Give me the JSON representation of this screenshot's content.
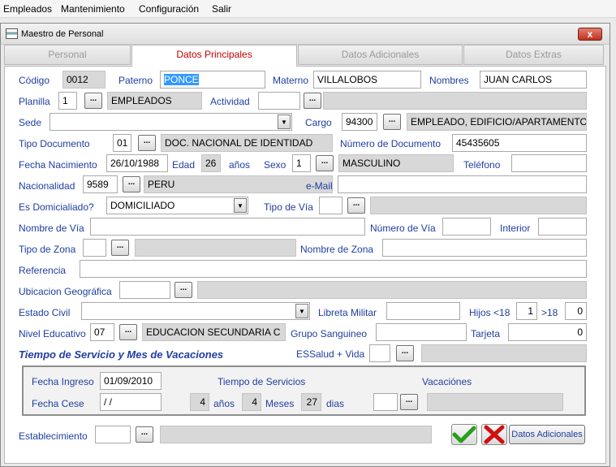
{
  "menu": {
    "empleados": "Empleados",
    "mantenimiento": "Mantenimiento",
    "configuracion": "Configuración",
    "salir": "Salir"
  },
  "window": {
    "title": "Maestro de Personal",
    "close": "x"
  },
  "tabs": {
    "personal": "Personal",
    "principales": "Datos Principales",
    "adicionales": "Datos Adicionales",
    "extras": "Datos Extras"
  },
  "labels": {
    "codigo": "Código",
    "paterno": "Paterno",
    "materno": "Materno",
    "nombres": "Nombres",
    "planilla": "Planilla",
    "actividad": "Actividad",
    "sede": "Sede",
    "cargo": "Cargo",
    "tipo_documento": "Tipo Documento",
    "numero_documento": "Número de Documento",
    "fecha_nacimiento": "Fecha Nacimiento",
    "edad": "Edad",
    "anos": "años",
    "sexo": "Sexo",
    "telefono": "Teléfono",
    "nacionalidad": "Nacionalidad",
    "email": "e-Mail",
    "es_domiciliado": "Es Domicialiado?",
    "tipo_via": "Tipo de Vía",
    "nombre_via": "Nombre de Vía",
    "numero_via": "Número de Vía",
    "interior": "Interior",
    "tipo_zona": "Tipo de Zona",
    "nombre_zona": "Nombre de Zona",
    "referencia": "Referencia",
    "ubicacion": "Ubicacion Geográfica",
    "estado_civil": "Estado Civil",
    "libreta_militar": "Libreta Militar",
    "hijos_menor": "Hijos <18",
    "hijos_mayor": ">18",
    "nivel_educativo": "Nivel Educativo",
    "grupo_sanguineo": "Grupo Sanguineo",
    "tarjeta": "Tarjeta",
    "essalud": "ESSalud + Vida",
    "fecha_ingreso": "Fecha Ingreso",
    "fecha_cese": "Fecha Cese",
    "tiempo_servicios": "Tiempo de Servicios",
    "vacaciones": "Vacaciónes",
    "anos2": "años",
    "meses": "Meses",
    "dias": "dias",
    "establecimiento": "Establecimiento"
  },
  "section_title": "Tiempo de Servicio y Mes de Vacaciones",
  "values": {
    "codigo": "0012",
    "paterno": "PONCE",
    "materno": "VILLALOBOS",
    "nombres": "JUAN CARLOS",
    "planilla_code": "1",
    "planilla_desc": "EMPLEADOS",
    "actividad": "",
    "sede": "",
    "cargo_code": "94300",
    "cargo_desc": "EMPLEADO, EDIFICIO/APARTAMENTO",
    "tipo_doc_code": "01",
    "tipo_doc_desc": "DOC. NACIONAL DE IDENTIDAD",
    "numero_documento": "45435605",
    "fecha_nacimiento": "26/10/1988",
    "edad": "26",
    "sexo_code": "1",
    "sexo_desc": "MASCULINO",
    "telefono": "",
    "nacionalidad_code": "9589",
    "nacionalidad_desc": "PERU",
    "email": "",
    "domiciliado": "DOMICILIADO",
    "tipo_via": "",
    "nombre_via": "",
    "numero_via": "",
    "interior": "",
    "tipo_zona": "",
    "nombre_zona": "",
    "referencia": "",
    "ubicacion": "",
    "estado_civil": "",
    "libreta_militar": "",
    "hijos_menor": "1",
    "hijos_mayor": "0",
    "nivel_code": "07",
    "nivel_desc": "EDUCACION SECUNDARIA C",
    "grupo_sanguineo": "",
    "tarjeta": "0",
    "essalud": "",
    "fecha_ingreso": "01/09/2010",
    "fecha_cese": " / /",
    "anos": "4",
    "meses": "4",
    "dias": "27",
    "vacaciones": "",
    "establecimiento": ""
  },
  "buttons": {
    "lookup": "...",
    "datos_adicionales": "Datos Adicionales"
  },
  "icons": {
    "combo_arrow": "▼",
    "ok": "check-icon",
    "cancel": "x-icon"
  },
  "colors": {
    "label": "#1f3ea0",
    "active_tab": "#c00000",
    "ok": "#2a9d1f",
    "cancel": "#d01010"
  }
}
